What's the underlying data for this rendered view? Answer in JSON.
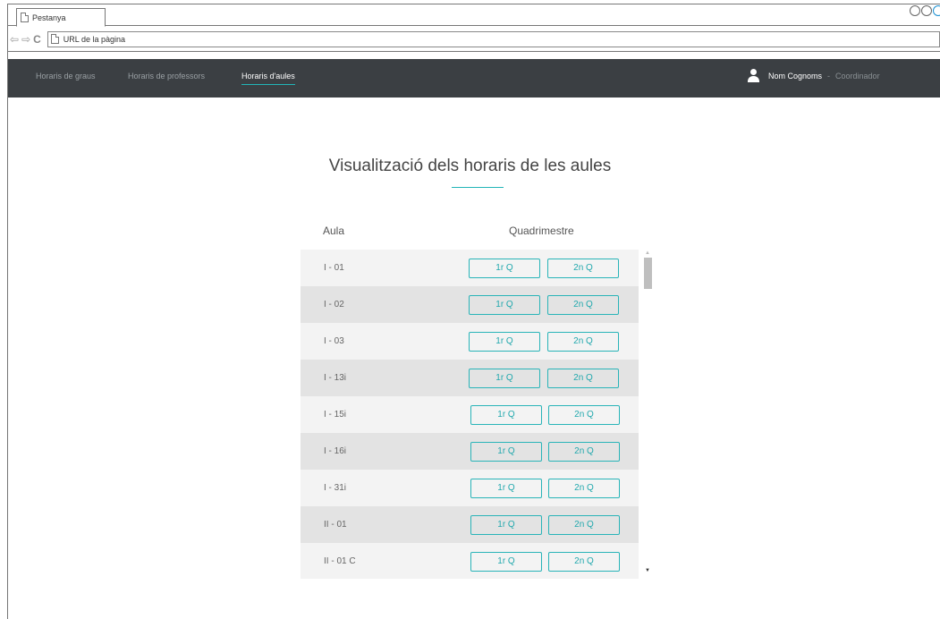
{
  "browser": {
    "tab_title": "Pestanya",
    "url_placeholder": "URL de la pàgina",
    "back_glyph": "⇦",
    "forward_glyph": "⇨",
    "reload_glyph": "C"
  },
  "navbar": {
    "links": [
      {
        "label": "Horaris de graus",
        "active": false
      },
      {
        "label": "Horaris de professors",
        "active": false
      },
      {
        "label": "Horaris d'aules",
        "active": true
      }
    ],
    "user": {
      "name": "Nom Cognoms",
      "separator": "-",
      "role": "Coordinador"
    }
  },
  "main": {
    "title": "Visualització dels horaris de les aules",
    "columns": {
      "room": "Aula",
      "term": "Quadrimestre"
    },
    "rows": [
      {
        "room": "I - 01",
        "q1": "1r Q",
        "q2": "2n Q"
      },
      {
        "room": "I - 02",
        "q1": "1r Q",
        "q2": "2n Q"
      },
      {
        "room": "I - 03",
        "q1": "1r Q",
        "q2": "2n Q"
      },
      {
        "room": "I - 13i",
        "q1": "1r Q",
        "q2": "2n Q"
      },
      {
        "room": "I - 15i",
        "q1": "1r Q",
        "q2": "2n Q"
      },
      {
        "room": "I - 16i",
        "q1": "1r Q",
        "q2": "2n Q"
      },
      {
        "room": "I - 31i",
        "q1": "1r Q",
        "q2": "2n Q"
      },
      {
        "room": "II - 01",
        "q1": "1r Q",
        "q2": "2n Q"
      },
      {
        "room": "II - 01 C",
        "q1": "1r Q",
        "q2": "2n Q"
      }
    ]
  },
  "colors": {
    "navbar_bg": "#3b3f43",
    "accent": "#22b5b8",
    "row_light": "#f3f3f3",
    "row_dark": "#e3e3e3"
  }
}
